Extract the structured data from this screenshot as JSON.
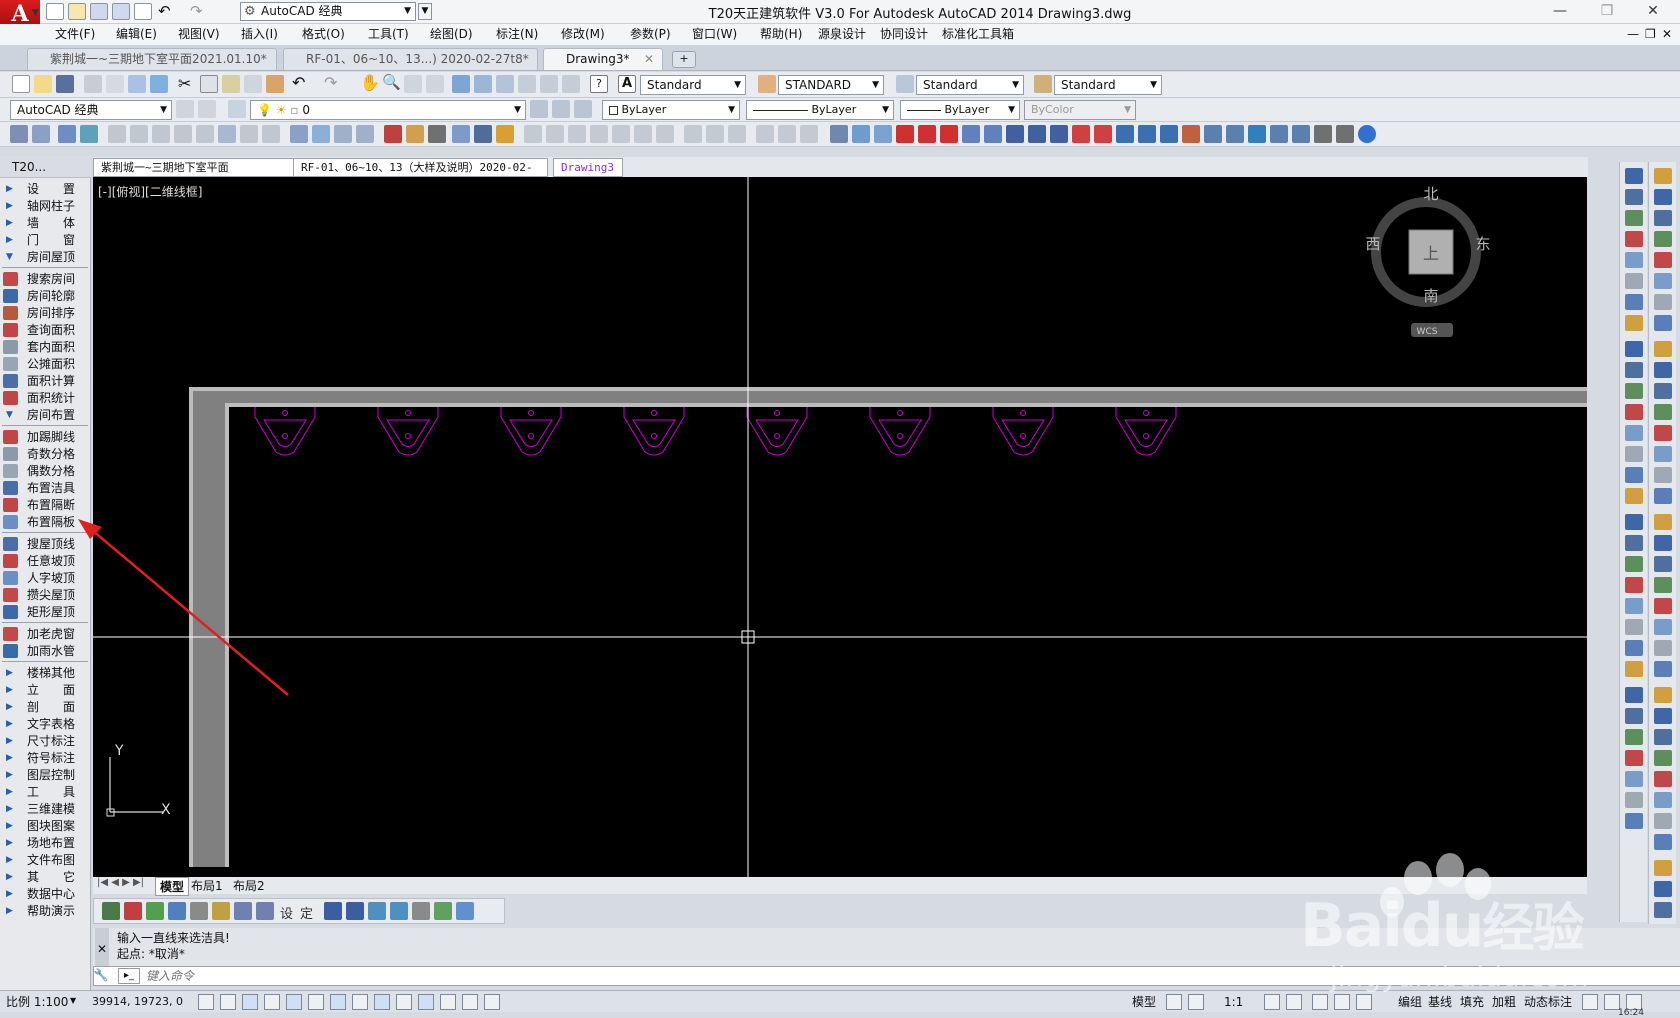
{
  "app": {
    "title": "T20天正建筑软件 V3.0 For Autodesk AutoCAD 2014    Drawing3.dwg",
    "workspace": "AutoCAD 经典"
  },
  "menu": [
    "文件(F)",
    "编辑(E)",
    "视图(V)",
    "插入(I)",
    "格式(O)",
    "工具(T)",
    "绘图(D)",
    "标注(N)",
    "修改(M)",
    "参数(P)",
    "窗口(W)",
    "帮助(H)",
    "源泉设计",
    "协同设计",
    "标准化工具箱"
  ],
  "doc_tabs": [
    {
      "label": "紫荆城一~三期地下室平面2021.01.10*"
    },
    {
      "label": "RF-01、06~10、13...) 2020-02-27t8*"
    },
    {
      "label": "Drawing3*"
    }
  ],
  "styles": {
    "text_style": "Standard",
    "dim_style": "STANDARD",
    "table_style": "Standard",
    "mleader_style": "Standard"
  },
  "properties": {
    "workspace": "AutoCAD 经典",
    "layer": "0",
    "color": "ByLayer",
    "linetype": "ByLayer",
    "lineweight": "ByLayer",
    "plotstyle": "ByColor"
  },
  "left_panel": {
    "title": "T20...",
    "groups": [
      [
        "设　　置",
        "轴网柱子",
        "墙　　体",
        "门　　窗",
        "房间屋顶"
      ],
      [
        "搜索房间",
        "房间轮廓",
        "房间排序",
        "查询面积",
        "套内面积",
        "公摊面积",
        "面积计算",
        "面积统计",
        "房间布置"
      ],
      [
        "加踢脚线",
        "奇数分格",
        "偶数分格",
        "布置洁具",
        "布置隔断",
        "布置隔板"
      ],
      [
        "搜屋顶线",
        "任意坡顶",
        "人字坡顶",
        "攒尖屋顶",
        "矩形屋顶"
      ],
      [
        "加老虎窗",
        "加雨水管"
      ],
      [
        "楼梯其他",
        "立　　面",
        "剖　　面",
        "文字表格",
        "尺寸标注",
        "符号标注",
        "图层控制",
        "工　　具",
        "三维建模",
        "图块图案",
        "场地布置",
        "文件布图",
        "其　　它",
        "数据中心",
        "帮助演示"
      ]
    ]
  },
  "drawing_tabs": [
    {
      "label": "紫荆城一~三期地下室平面2021.01.10"
    },
    {
      "label": "RF-01、06~10、13（大样及说明）2020-02-27t8"
    },
    {
      "label": "Drawing3"
    }
  ],
  "viewport": {
    "label": "[-][俯视][二维线框]",
    "compass": {
      "north": "北",
      "south": "南",
      "east": "东",
      "west": "西",
      "center": "上",
      "wcs": "WCS"
    },
    "ucs": {
      "x": "X",
      "y": "Y"
    },
    "fixture_count": 8
  },
  "layout_tabs": [
    "模型",
    "布局1",
    "布局2"
  ],
  "bottom_toolbar": [
    "设",
    "定"
  ],
  "command": {
    "history": [
      "输入一直线来选洁具!",
      "起点: *取消*"
    ],
    "placeholder": "键入命令"
  },
  "status": {
    "scale": "比例 1:100",
    "coords": "39914,  19723,  0",
    "model": "模型",
    "annotation_scale": "1:1",
    "buttons": [
      "编组",
      "基线",
      "填充",
      "加粗",
      "动态标注"
    ],
    "time": "16:24"
  },
  "watermark": {
    "brand": "Baidu",
    "suffix": "经验",
    "url": "jingyan.baidu.com"
  },
  "colors": {
    "canvas": "#000000",
    "wall": "#808080",
    "fixture": "#cc00cc",
    "crosshair": "#ffffff",
    "arrow": "#e02020"
  }
}
